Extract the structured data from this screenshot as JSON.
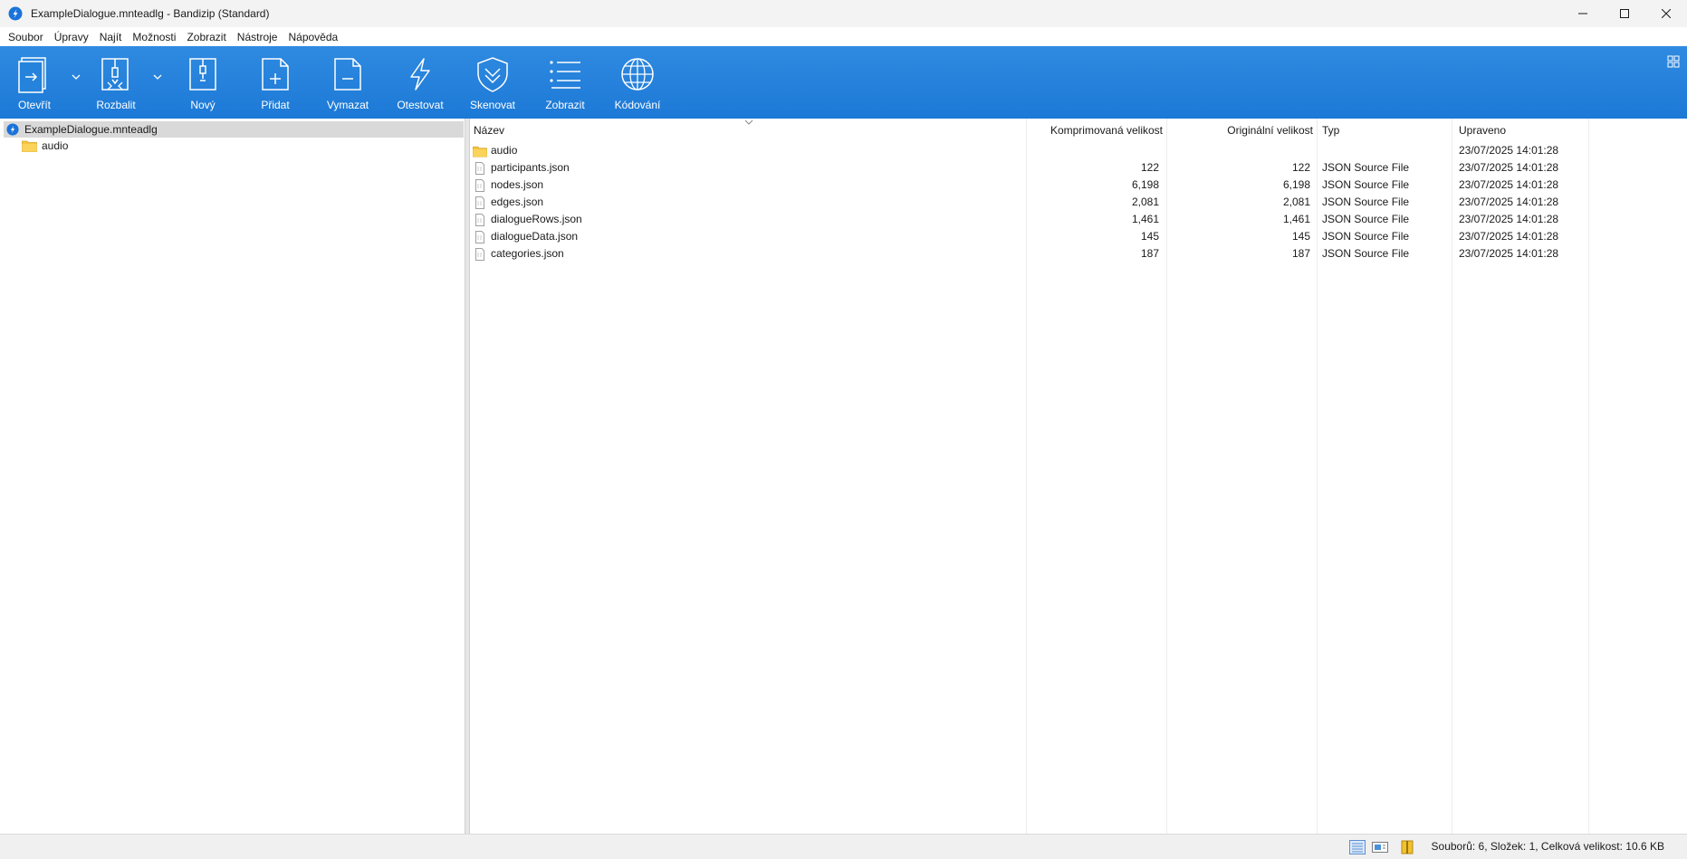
{
  "window": {
    "title": "ExampleDialogue.mnteadlg - Bandizip (Standard)",
    "icons": [
      "bandizip-logo-icon",
      "minimize-icon",
      "maximize-icon",
      "close-icon"
    ]
  },
  "menu": [
    "Soubor",
    "Úpravy",
    "Najít",
    "Možnosti",
    "Zobrazit",
    "Nástroje",
    "Nápověda"
  ],
  "toolbar": {
    "background": "#1c79d6",
    "buttons": [
      {
        "label": "Otevřít",
        "icon": "open-archive-icon"
      },
      {
        "label": "Rozbalit",
        "icon": "extract-icon"
      },
      {
        "label": "Nový",
        "icon": "new-archive-icon"
      },
      {
        "label": "Přidat",
        "icon": "add-file-icon"
      },
      {
        "label": "Vymazat",
        "icon": "delete-file-icon"
      },
      {
        "label": "Otestovat",
        "icon": "lightning-icon"
      },
      {
        "label": "Skenovat",
        "icon": "shield-icon"
      },
      {
        "label": "Zobrazit",
        "icon": "list-view-icon"
      },
      {
        "label": "Kódování",
        "icon": "globe-icon"
      }
    ]
  },
  "tree": {
    "root": "ExampleDialogue.mnteadlg",
    "children": [
      "audio"
    ]
  },
  "list": {
    "columns": {
      "name": "Název",
      "compressed": "Komprimovaná velikost",
      "original": "Originální velikost",
      "type": "Typ",
      "modified": "Upraveno"
    },
    "rows": [
      {
        "name": "audio",
        "kind": "folder",
        "compressed": "",
        "original": "",
        "type": "",
        "modified": "23/07/2025 14:01:28"
      },
      {
        "name": "participants.json",
        "kind": "file",
        "compressed": "122",
        "original": "122",
        "type": "JSON Source File",
        "modified": "23/07/2025 14:01:28"
      },
      {
        "name": "nodes.json",
        "kind": "file",
        "compressed": "6,198",
        "original": "6,198",
        "type": "JSON Source File",
        "modified": "23/07/2025 14:01:28"
      },
      {
        "name": "edges.json",
        "kind": "file",
        "compressed": "2,081",
        "original": "2,081",
        "type": "JSON Source File",
        "modified": "23/07/2025 14:01:28"
      },
      {
        "name": "dialogueRows.json",
        "kind": "file",
        "compressed": "1,461",
        "original": "1,461",
        "type": "JSON Source File",
        "modified": "23/07/2025 14:01:28"
      },
      {
        "name": "dialogueData.json",
        "kind": "file",
        "compressed": "145",
        "original": "145",
        "type": "JSON Source File",
        "modified": "23/07/2025 14:01:28"
      },
      {
        "name": "categories.json",
        "kind": "file",
        "compressed": "187",
        "original": "187",
        "type": "JSON Source File",
        "modified": "23/07/2025 14:01:28"
      }
    ]
  },
  "status": {
    "text": "Souborů: 6, Složek: 1, Celková velikost: 10.6 KB"
  }
}
